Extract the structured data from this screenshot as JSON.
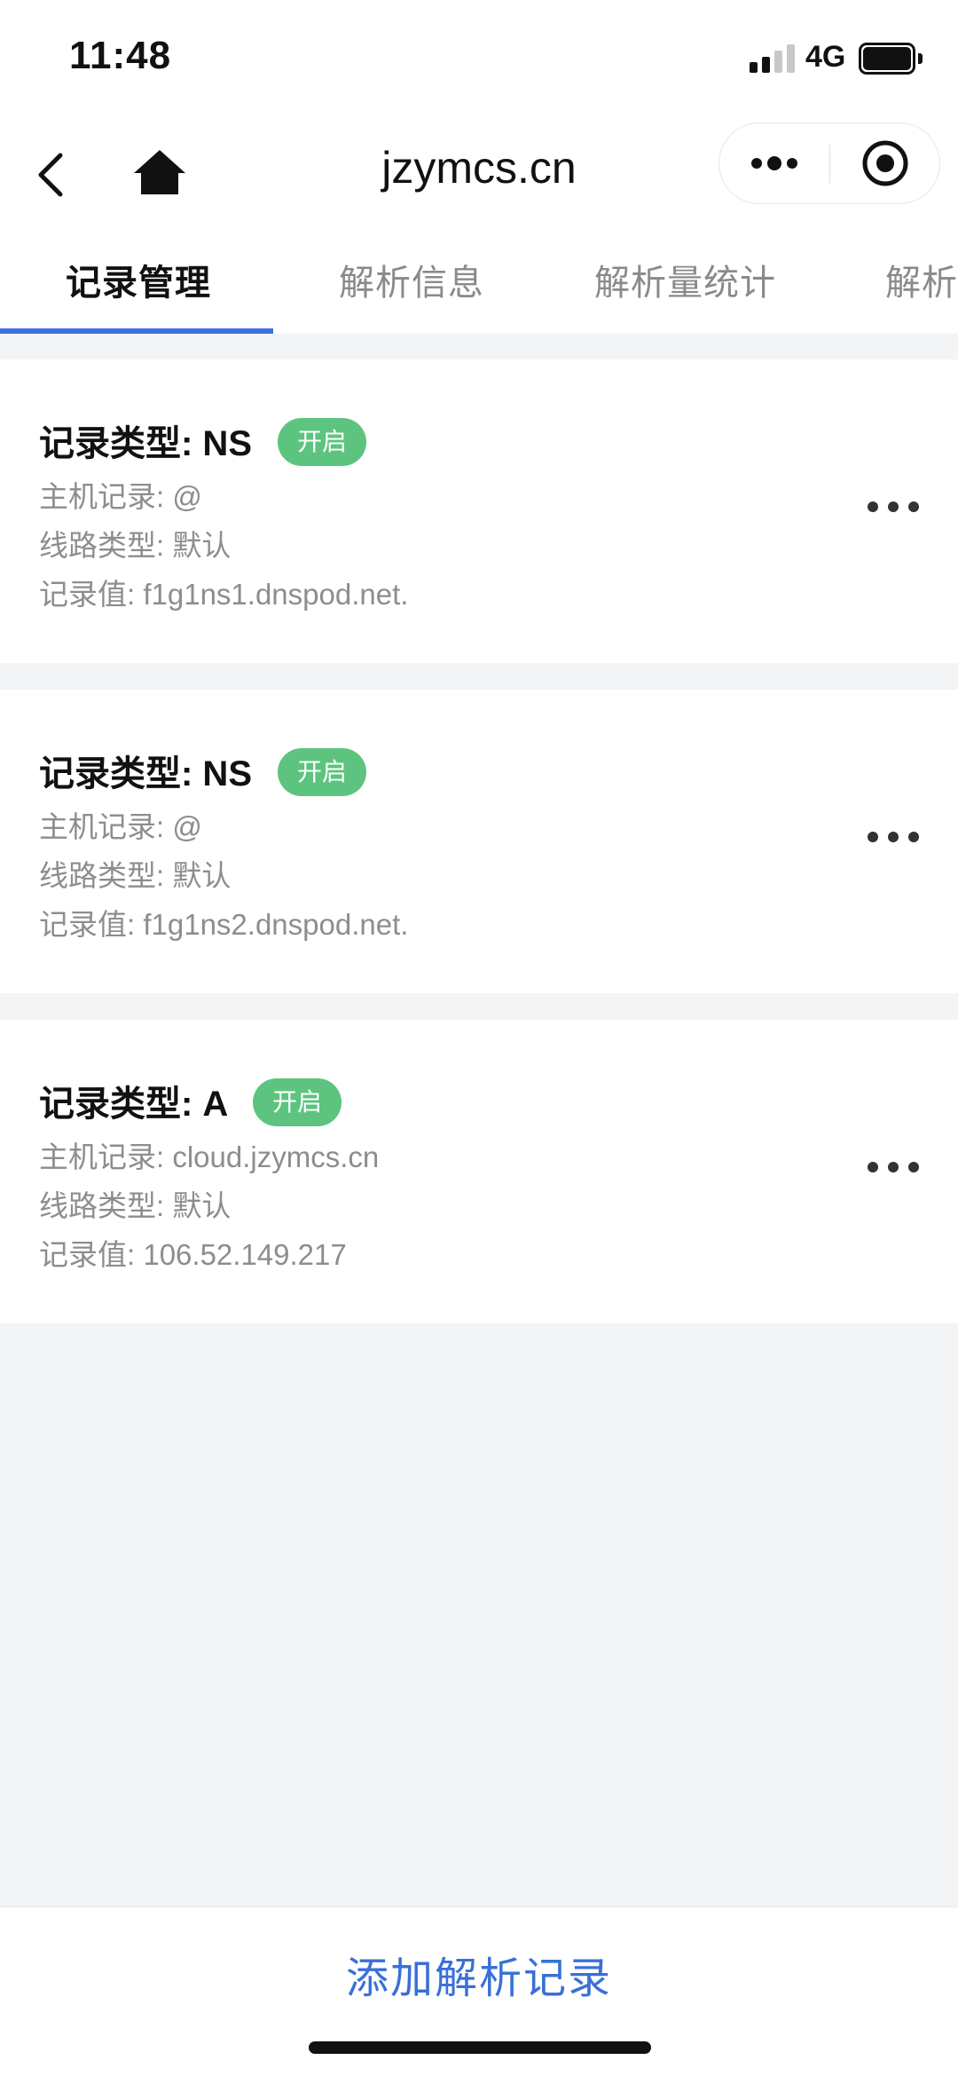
{
  "status_bar": {
    "time": "11:48",
    "network": "4G"
  },
  "nav": {
    "title": "jzymcs.cn"
  },
  "tabs": [
    {
      "label": "记录管理"
    },
    {
      "label": "解析信息"
    },
    {
      "label": "解析量统计"
    },
    {
      "label": "解析"
    }
  ],
  "records": [
    {
      "title": "记录类型: NS",
      "status": "开启",
      "host": "主机记录: @",
      "line": "线路类型: 默认",
      "value": "记录值: f1g1ns1.dnspod.net."
    },
    {
      "title": "记录类型: NS",
      "status": "开启",
      "host": "主机记录: @",
      "line": "线路类型: 默认",
      "value": "记录值: f1g1ns2.dnspod.net."
    },
    {
      "title": "记录类型: A",
      "status": "开启",
      "host": "主机记录: cloud.jzymcs.cn",
      "line": "线路类型: 默认",
      "value": "记录值: 106.52.149.217"
    }
  ],
  "bottom": {
    "add_label": "添加解析记录"
  },
  "colors": {
    "accent": "#3d6fe5",
    "badge": "#5cc47e",
    "background": "#f3f4f6"
  }
}
